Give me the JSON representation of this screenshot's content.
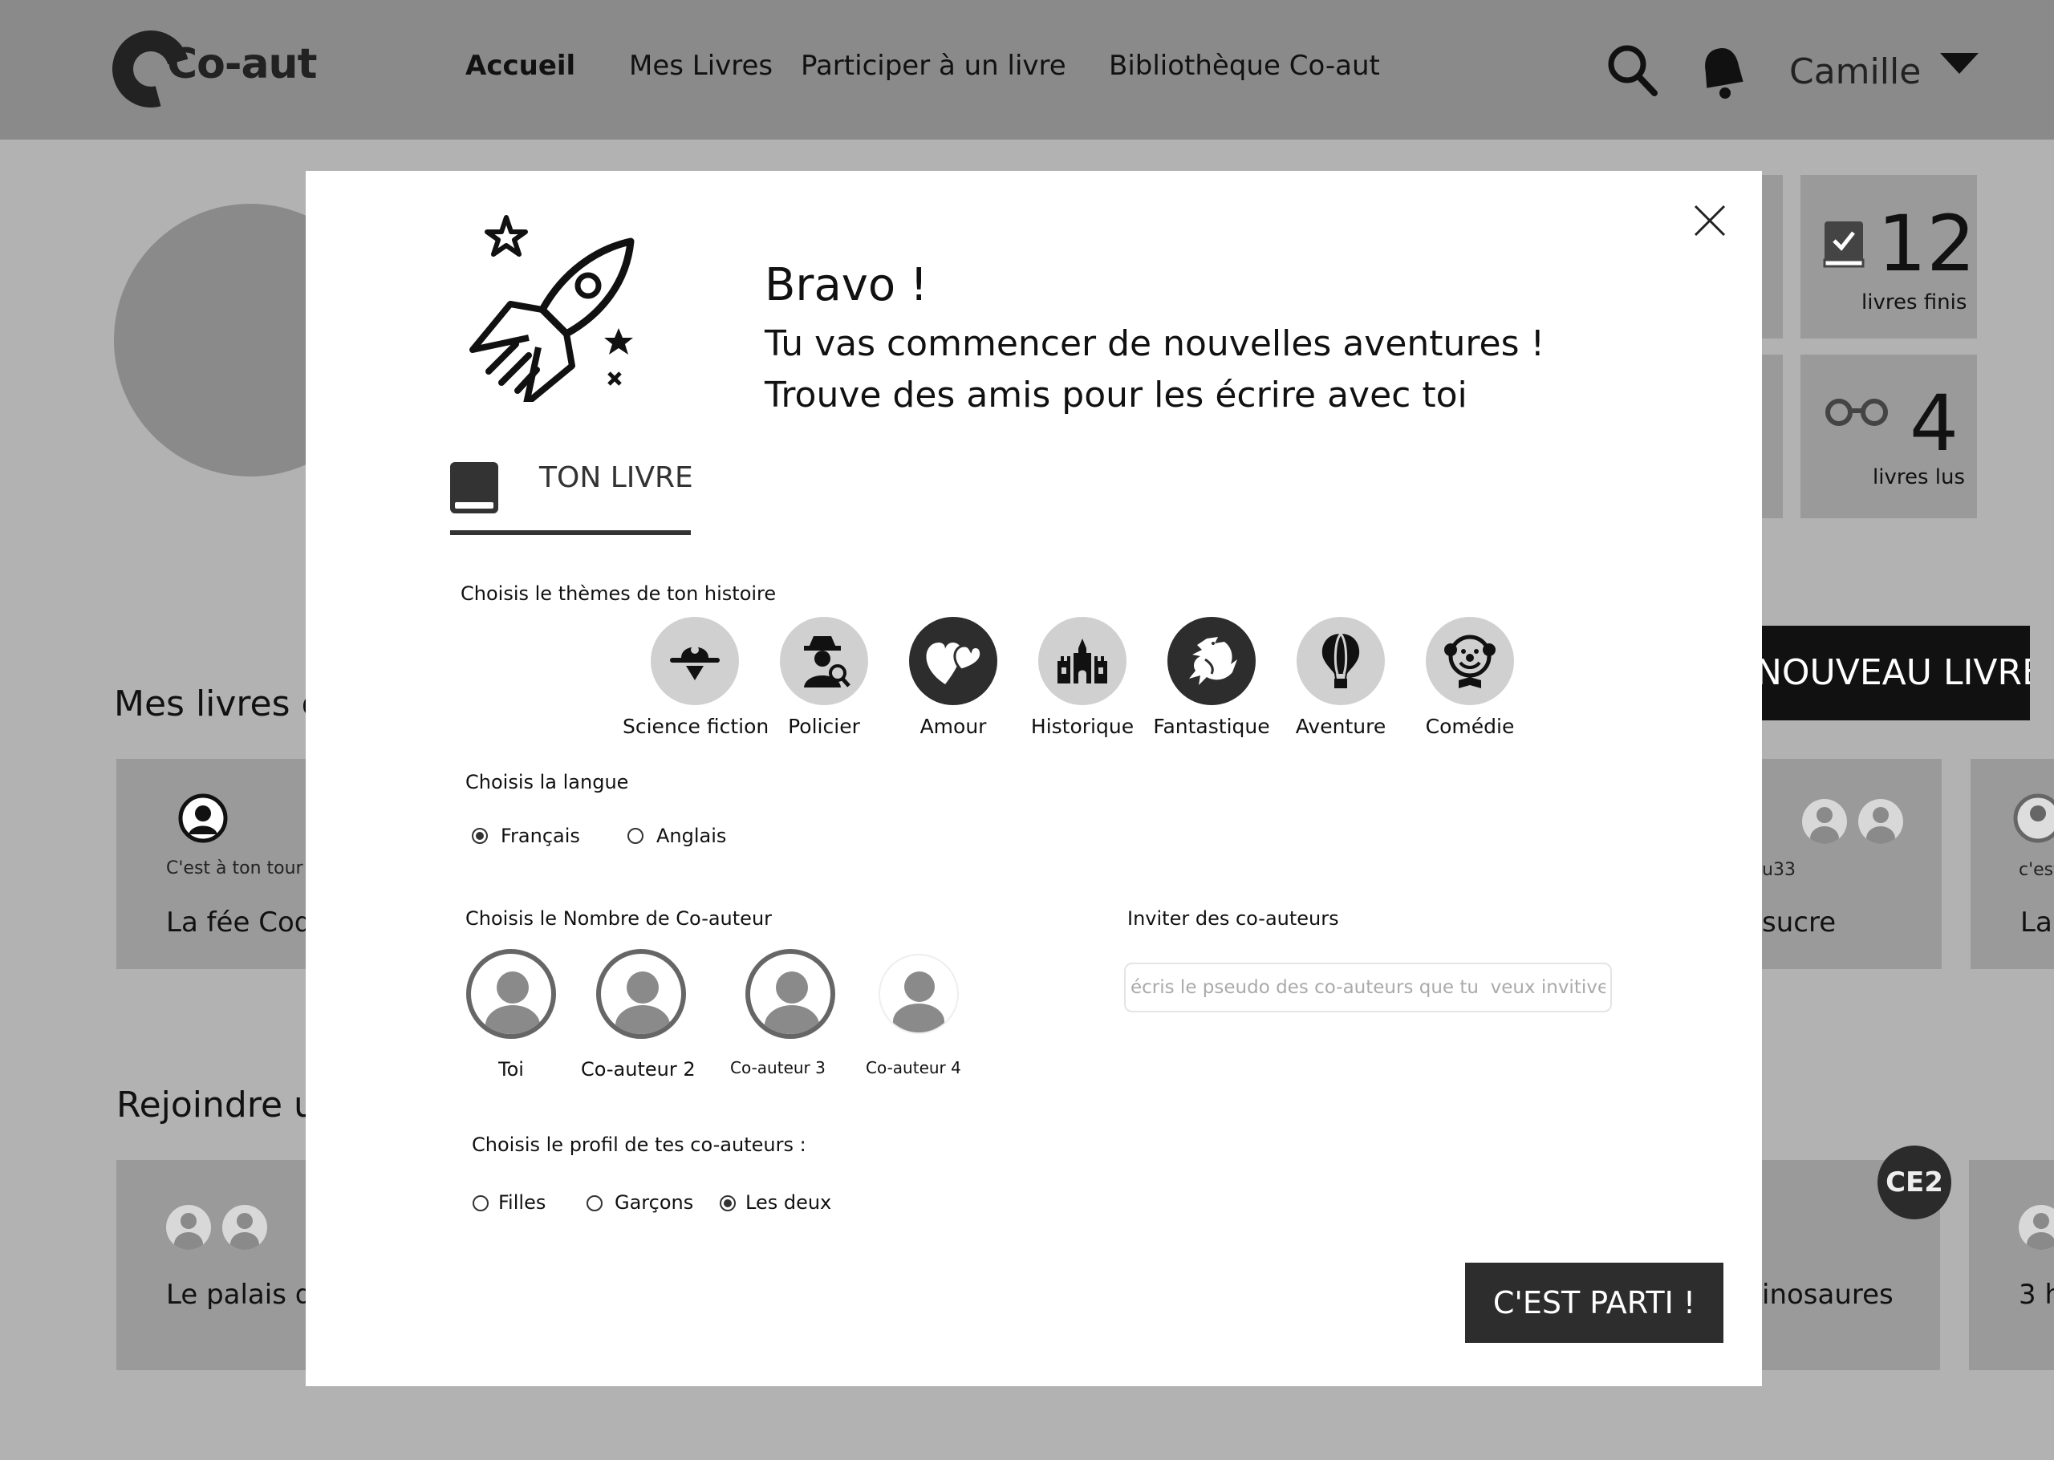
{
  "header": {
    "logo": "Co-aut",
    "nav": [
      "Accueil",
      "Mes Livres",
      "Participer à un livre",
      "Bibliothèque  Co-aut"
    ],
    "user": "Camille"
  },
  "stats": [
    {
      "value": "12",
      "label": "livres finis"
    },
    {
      "value": "4",
      "label": "livres lus"
    }
  ],
  "background": {
    "new_book_button": "NOUVEAU LIVRE",
    "section_my_books": "Mes livres e",
    "section_join": "Rejoindre u",
    "card_my_turn": "C'est à ton tour",
    "card_fee": "La fée Coq",
    "card_sucre": "sucre",
    "card_u33": "u33",
    "card_cest": "c'est",
    "card_la": "La",
    "card_palais": "Le palais du",
    "card_dino": "inosaures",
    "card_3h": "3 h",
    "badge": "CE2"
  },
  "modal": {
    "title": "Bravo !",
    "subtitle_1": "Tu vas commencer  de nouvelles aventures !",
    "subtitle_2": "Trouve des amis pour les écrire avec toi",
    "tab_label": "TON LIVRE",
    "themes_label": "Choisis le thèmes de ton histoire",
    "themes": [
      {
        "label": "Science fiction",
        "icon": "alien-hat-icon",
        "selected": false
      },
      {
        "label": "Policier",
        "icon": "detective-icon",
        "selected": false
      },
      {
        "label": "Amour",
        "icon": "hearts-icon",
        "selected": true
      },
      {
        "label": "Historique",
        "icon": "castle-icon",
        "selected": false
      },
      {
        "label": "Fantastique",
        "icon": "dragon-icon",
        "selected": true
      },
      {
        "label": "Aventure",
        "icon": "hot-air-balloon-icon",
        "selected": false
      },
      {
        "label": "Comédie",
        "icon": "clown-icon",
        "selected": false
      }
    ],
    "language_label": "Choisis la langue",
    "languages": [
      {
        "label": "Français",
        "selected": true
      },
      {
        "label": "Anglais",
        "selected": false
      }
    ],
    "coauthors_label": "Choisis le Nombre de Co-auteur",
    "coauthors": [
      "Toi",
      "Co-auteur 2",
      "Co-auteur 3",
      "Co-auteur 4"
    ],
    "invite_label": "Inviter des co-auteurs",
    "invite_placeholder": "écris le pseudo des co-auteurs que tu  veux invitiver",
    "profile_label": "Choisis le profil de tes co-auteurs :",
    "profiles": [
      {
        "label": "Filles",
        "selected": false
      },
      {
        "label": "Garçons",
        "selected": false
      },
      {
        "label": "Les deux",
        "selected": true
      }
    ],
    "submit": "C'EST PARTI !"
  }
}
